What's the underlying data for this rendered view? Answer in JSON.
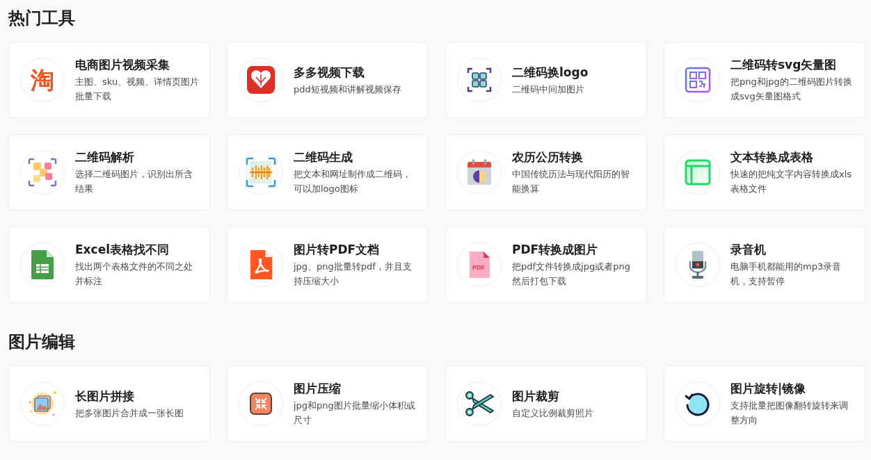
{
  "sections": [
    {
      "title": "热门工具",
      "tools": [
        {
          "kind": "taobao",
          "icon_text": "淘",
          "name": "电商图片视频采集",
          "desc": "主图、sku、视频、详情页图片批量下载"
        },
        {
          "kind": "pinduoduo",
          "name": "多多视频下载",
          "desc": "pdd短视频和讲解视频保存"
        },
        {
          "kind": "qr-frame",
          "name": "二维码换logo",
          "desc": "二维码中间加图片"
        },
        {
          "kind": "qr-svg",
          "name": "二维码转svg矢量图",
          "desc": "把png和jpg的二维码图片转换成svg矢量图格式"
        },
        {
          "kind": "qr-scan",
          "name": "二维码解析",
          "desc": "选择二维码图片，识别出所含结果"
        },
        {
          "kind": "qr-generate",
          "name": "二维码生成",
          "desc": "把文本和网址制作成二维码，可以加logo图标"
        },
        {
          "kind": "calendar",
          "name": "农历公历转换",
          "desc": "中国传统历法与现代阳历的智能换算"
        },
        {
          "kind": "table",
          "name": "文本转换成表格",
          "desc": "快速的把纯文字内容转换成xls表格文件"
        },
        {
          "kind": "sheet",
          "name": "Excel表格找不同",
          "desc": "找出两个表格文件的不同之处并标注"
        },
        {
          "kind": "pdf-doc",
          "name": "图片转PDF文档",
          "desc": "jpg、png批量转pdf，并且支持压缩大小"
        },
        {
          "kind": "pdf-file",
          "icon_text": "PDF",
          "name": "PDF转换成图片",
          "desc": "把pdf文件转换成jpg或者png然后打包下载"
        },
        {
          "kind": "microphone",
          "name": "录音机",
          "desc": "电脑手机都能用的mp3录音机，支持暂停"
        }
      ]
    },
    {
      "title": "图片编辑",
      "tools": [
        {
          "kind": "images",
          "name": "长图片拼接",
          "desc": "把多张图片合并成一张长图"
        },
        {
          "kind": "compress",
          "name": "图片压缩",
          "desc": "jpg和png图片批量缩小体积或尺寸"
        },
        {
          "kind": "scissors",
          "name": "图片裁剪",
          "desc": "自定义比例裁剪照片"
        },
        {
          "kind": "rotate",
          "name": "图片旋转|镜像",
          "desc": "支持批量把图像翻转旋转来调整方向"
        }
      ]
    }
  ]
}
